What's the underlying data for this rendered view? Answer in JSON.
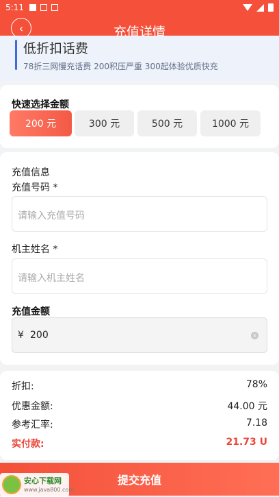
{
  "status_bar": {
    "time": "5:11"
  },
  "nav": {
    "title": "充值详情",
    "back_icon": "chevron-left-icon"
  },
  "hero": {
    "title": "低折扣话费",
    "subtitle": "78折三网慢充话费 200积压严重 300起体验优质快充"
  },
  "quick_amount": {
    "label": "快速选择金额",
    "options": [
      "200 元",
      "300 元",
      "500 元",
      "1000 元"
    ],
    "selected": "200 元"
  },
  "recharge_info": {
    "section_title": "充值信息",
    "phone_label": "充值号码 *",
    "phone_placeholder": "请输入充值号码",
    "name_label": "机主姓名 *",
    "name_placeholder": "请输入机主姓名",
    "amount_label": "充值金额",
    "currency": "¥",
    "amount_value": "200"
  },
  "summary": {
    "rows": [
      {
        "label": "折扣:",
        "value": "78%"
      },
      {
        "label": "优惠金额:",
        "value": "44.00 元"
      },
      {
        "label": "参考汇率:",
        "value": "7.18"
      }
    ],
    "total_label": "实付款:",
    "total_value": "21.73 U"
  },
  "submit_label": "提交充值",
  "watermark": {
    "text": "安心下载网",
    "url": "www.java800.com"
  },
  "colors": {
    "primary": "#f4503a",
    "accent_text": "#e9473b",
    "hero_bar": "#3b6cd8"
  }
}
